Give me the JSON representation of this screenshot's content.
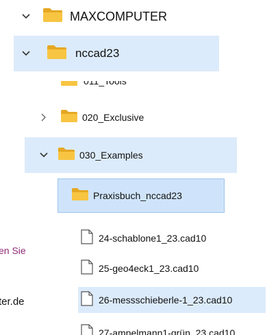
{
  "tree": {
    "root": {
      "label": "MAXCOMPUTER"
    },
    "nccad": {
      "label": "nccad23"
    },
    "tools": {
      "label": "011_Tools"
    },
    "exclusive": {
      "label": "020_Exclusive"
    },
    "examples": {
      "label": "030_Examples"
    },
    "praxis": {
      "label": "Praxisbuch_nccad23"
    },
    "files": [
      {
        "label": "24-schablone1_23.cad10"
      },
      {
        "label": "25-geo4eck1_23.cad10"
      },
      {
        "label": "26-messschieberle-1_23.cad10"
      },
      {
        "label": "27-ampelmann1-grün_23.cad10"
      }
    ]
  },
  "background_text": {
    "purple_fragment": "en Sie",
    "domain_fragment": "ter.de"
  },
  "colors": {
    "folder_yellow": "#f8c542",
    "folder_dark": "#e5a823",
    "selection_blue": "#dcebfb",
    "selection_border": "#9cc4ee",
    "purple_text": "#8e2a76"
  },
  "icons": {
    "expanded": "chevron-down-icon",
    "collapsed": "chevron-right-icon",
    "folder": "folder-icon",
    "file": "file-icon"
  }
}
